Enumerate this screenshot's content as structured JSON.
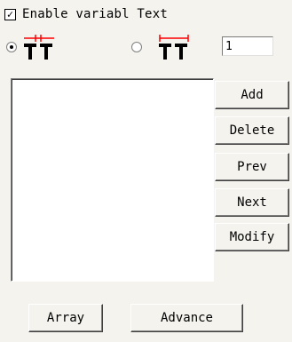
{
  "checkbox": {
    "label": "Enable variabl Text",
    "checked": true,
    "mark": "✓"
  },
  "spacing_mode": {
    "options": [
      {
        "id": "mode-a",
        "selected": true,
        "icon": "text-spacing-icon"
      },
      {
        "id": "mode-b",
        "selected": false,
        "icon": "text-width-icon"
      }
    ]
  },
  "count_input": {
    "value": "1"
  },
  "text_list": {
    "items": []
  },
  "buttons": {
    "add": "Add",
    "delete": "Delete",
    "prev": "Prev",
    "next": "Next",
    "modify": "Modify",
    "array": "Array",
    "advance": "Advance"
  },
  "colors": {
    "accent_red": "#ff0000"
  }
}
